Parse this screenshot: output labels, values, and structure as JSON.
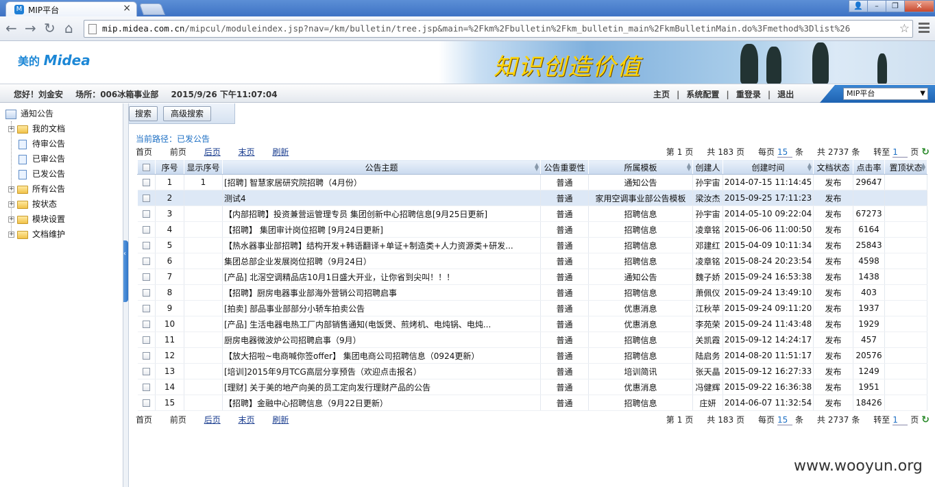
{
  "browser": {
    "tab_title": "MIP平台",
    "tab_close": "×",
    "url_host": "mip.midea.com.cn",
    "url_path": "/mipcul/moduleindex.jsp?nav=/km/bulletin/tree.jsp&main=%2Fkm%2Fbulletin%2Fkm_bulletin_main%2FkmBulletinMain.do%3Fmethod%3Dlist%26",
    "window_buttons": [
      "👤",
      "–",
      "❐",
      "✕"
    ]
  },
  "header": {
    "logo_cn": "美的",
    "logo_en": "Midea",
    "slogan": "知识创造价值"
  },
  "userbar": {
    "greeting": "您好！刘金安",
    "location": "场所：006冰箱事业部",
    "datetime": "2015/9/26  下午11:07:04",
    "nav": [
      "主页",
      "系统配置",
      "重登录",
      "退出"
    ],
    "system_select": "MIP平台"
  },
  "sidebar": {
    "root": "通知公告",
    "items": [
      {
        "label": "我的文档",
        "type": "folder",
        "expandable": true
      },
      {
        "label": "待审公告",
        "type": "doc",
        "expandable": false
      },
      {
        "label": "已审公告",
        "type": "doc",
        "expandable": false
      },
      {
        "label": "已发公告",
        "type": "doc",
        "expandable": false
      },
      {
        "label": "所有公告",
        "type": "folder",
        "expandable": true
      },
      {
        "label": "按状态",
        "type": "folder",
        "expandable": true
      },
      {
        "label": "模块设置",
        "type": "folder",
        "expandable": true
      },
      {
        "label": "文档维护",
        "type": "folder",
        "expandable": true
      }
    ]
  },
  "search": {
    "search_label": "搜索",
    "advanced_label": "高级搜索"
  },
  "breadcrumb": "当前路径：已发公告",
  "pager": {
    "first": "首页",
    "prev": "前页",
    "next": "后页",
    "last": "末页",
    "refresh": "刷新",
    "page_prefix": "第",
    "page_no": "1",
    "page_suffix": "页",
    "total_prefix": "共",
    "total_pages": "183",
    "per_page_prefix": "每页",
    "per_page": "15",
    "per_page_suffix": "条",
    "total_records": "2737",
    "goto_prefix": "转至",
    "goto_value": "1",
    "refresh_icon": "refresh-arrow-icon"
  },
  "table": {
    "columns": [
      "序号",
      "显示序号",
      "公告主题",
      "公告重要性",
      "所属模板",
      "创建人",
      "创建时间",
      "文档状态",
      "点击率",
      "置顶状态"
    ],
    "rows": [
      {
        "no": "1",
        "show": "1",
        "subject": "[招聘] 智慧家居研究院招聘（4月份）",
        "importance": "普通",
        "template": "通知公告",
        "creator": "孙宇宙",
        "time": "2014-07-15 11:14:45",
        "status": "发布",
        "clicks": "29647",
        "top": ""
      },
      {
        "no": "2",
        "show": "",
        "subject": "测试4",
        "importance": "普通",
        "template": "家用空调事业部公告模板",
        "creator": "梁汝杰",
        "time": "2015-09-25 17:11:23",
        "status": "发布",
        "clicks": "",
        "top": ""
      },
      {
        "no": "3",
        "show": "",
        "subject": "【内部招聘】投资兼营运管理专员 集团创新中心招聘信息[9月25日更新]",
        "importance": "普通",
        "template": "招聘信息",
        "creator": "孙宇宙",
        "time": "2014-05-10 09:22:04",
        "status": "发布",
        "clicks": "67273",
        "top": ""
      },
      {
        "no": "4",
        "show": "",
        "subject": "【招聘】 集团审计岗位招聘 [9月24日更新]",
        "importance": "普通",
        "template": "招聘信息",
        "creator": "凌章铭",
        "time": "2015-06-06 11:00:50",
        "status": "发布",
        "clicks": "6164",
        "top": ""
      },
      {
        "no": "5",
        "show": "",
        "subject": "【热水器事业部招聘】结构开发+韩语翻译+单证+制造类+人力资源类+研发...",
        "importance": "普通",
        "template": "招聘信息",
        "creator": "邓建红",
        "time": "2015-04-09 10:11:34",
        "status": "发布",
        "clicks": "25843",
        "top": ""
      },
      {
        "no": "6",
        "show": "",
        "subject": "集团总部企业发展岗位招聘（9月24日）",
        "importance": "普通",
        "template": "招聘信息",
        "creator": "凌章铭",
        "time": "2015-08-24 20:23:54",
        "status": "发布",
        "clicks": "4598",
        "top": ""
      },
      {
        "no": "7",
        "show": "",
        "subject": "[产品] 北滘空调精品店10月1日盛大开业，让你省到尖叫！！！",
        "importance": "普通",
        "template": "通知公告",
        "creator": "魏子娇",
        "time": "2015-09-24 16:53:38",
        "status": "发布",
        "clicks": "1438",
        "top": ""
      },
      {
        "no": "8",
        "show": "",
        "subject": "【招聘】厨房电器事业部海外营销公司招聘启事",
        "importance": "普通",
        "template": "招聘信息",
        "creator": "萧佩仪",
        "time": "2015-09-24 13:49:10",
        "status": "发布",
        "clicks": "403",
        "top": ""
      },
      {
        "no": "9",
        "show": "",
        "subject": "[拍卖] 部品事业部部分小轿车拍卖公告",
        "importance": "普通",
        "template": "优惠消息",
        "creator": "江秋苹",
        "time": "2015-09-24 09:11:20",
        "status": "发布",
        "clicks": "1937",
        "top": ""
      },
      {
        "no": "10",
        "show": "",
        "subject": "[产品] 生活电器电热工厂内部销售通知(电饭煲、煎烤机、电炖锅、电炖...",
        "importance": "普通",
        "template": "优惠消息",
        "creator": "李苑荣",
        "time": "2015-09-24 11:43:48",
        "status": "发布",
        "clicks": "1929",
        "top": ""
      },
      {
        "no": "11",
        "show": "",
        "subject": "厨房电器微波炉公司招聘启事（9月）",
        "importance": "普通",
        "template": "招聘信息",
        "creator": "关凯霞",
        "time": "2015-09-12 14:24:17",
        "status": "发布",
        "clicks": "457",
        "top": ""
      },
      {
        "no": "12",
        "show": "",
        "subject": "【放大招啦~电商喊你签offer】 集团电商公司招聘信息（0924更新）",
        "importance": "普通",
        "template": "招聘信息",
        "creator": "陆启务",
        "time": "2014-08-20 11:51:17",
        "status": "发布",
        "clicks": "20576",
        "top": ""
      },
      {
        "no": "13",
        "show": "",
        "subject": "[培训]2015年9月TCG高层分享预告（欢迎点击报名）",
        "importance": "普通",
        "template": "培训简讯",
        "creator": "张天晶",
        "time": "2015-09-12 16:27:33",
        "status": "发布",
        "clicks": "1249",
        "top": ""
      },
      {
        "no": "14",
        "show": "",
        "subject": "[理财] 关于美的地产向美的员工定向发行理财产品的公告",
        "importance": "普通",
        "template": "优惠消息",
        "creator": "冯健辉",
        "time": "2015-09-22 16:36:38",
        "status": "发布",
        "clicks": "1951",
        "top": ""
      },
      {
        "no": "15",
        "show": "",
        "subject": "【招聘】金融中心招聘信息（9月22日更新）",
        "importance": "普通",
        "template": "招聘信息",
        "creator": "庄妍",
        "time": "2014-06-07 11:32:54",
        "status": "发布",
        "clicks": "18426",
        "top": ""
      }
    ]
  },
  "watermark": "www.wooyun.org"
}
